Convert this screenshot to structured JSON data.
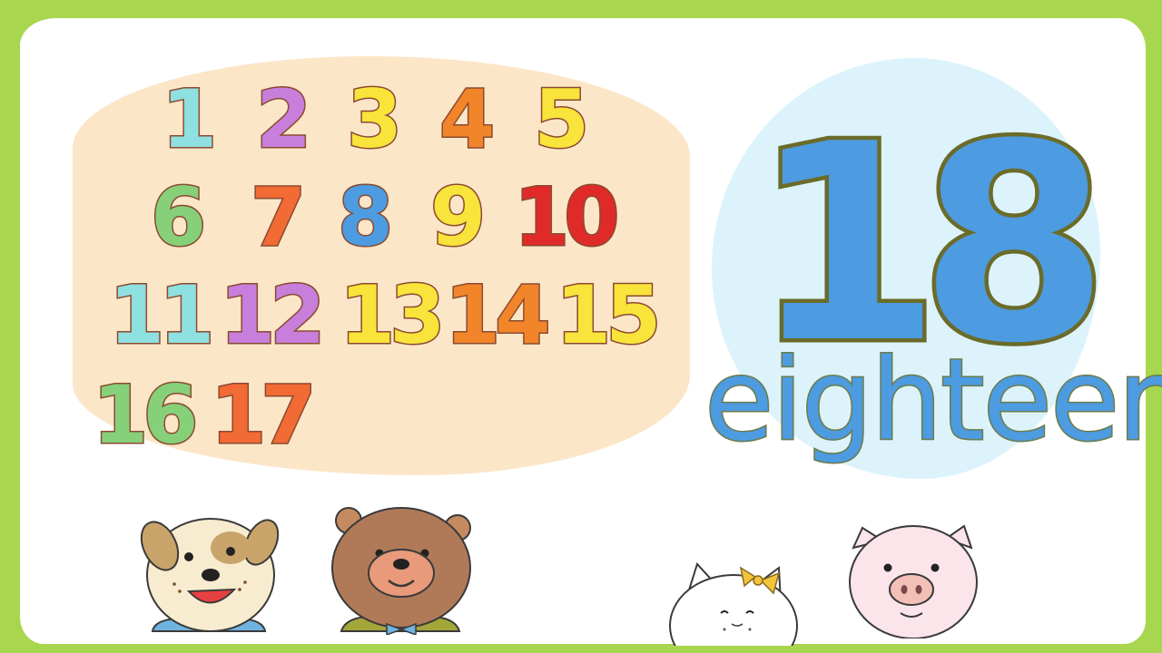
{
  "colors": {
    "border": "#a9d64f",
    "panel": "#fce6c8",
    "highlight_circle": "#dcf3fb",
    "highlight_number": "#4d9be0"
  },
  "numbers": [
    {
      "label": "1",
      "color": "#8fe0e0"
    },
    {
      "label": "2",
      "color": "#c77fdb"
    },
    {
      "label": "3",
      "color": "#f8e43a"
    },
    {
      "label": "4",
      "color": "#f2852a"
    },
    {
      "label": "5",
      "color": "#f8e43a"
    },
    {
      "label": "6",
      "color": "#86d07a"
    },
    {
      "label": "7",
      "color": "#f26a34"
    },
    {
      "label": "8",
      "color": "#4d9be0"
    },
    {
      "label": "9",
      "color": "#f8e43a"
    },
    {
      "label": "10",
      "color": "#e02a2a"
    },
    {
      "label": "11",
      "color": "#8fe0e0"
    },
    {
      "label": "12",
      "color": "#c77fdb"
    },
    {
      "label": "13",
      "color": "#f8e43a"
    },
    {
      "label": "14",
      "color": "#f2852a"
    },
    {
      "label": "15",
      "color": "#f8e43a"
    },
    {
      "label": "16",
      "color": "#86d07a"
    },
    {
      "label": "17",
      "color": "#f26a34"
    }
  ],
  "highlight": {
    "number": "18",
    "word": "eighteen"
  },
  "characters": [
    "dog",
    "bear",
    "cat",
    "pig"
  ]
}
